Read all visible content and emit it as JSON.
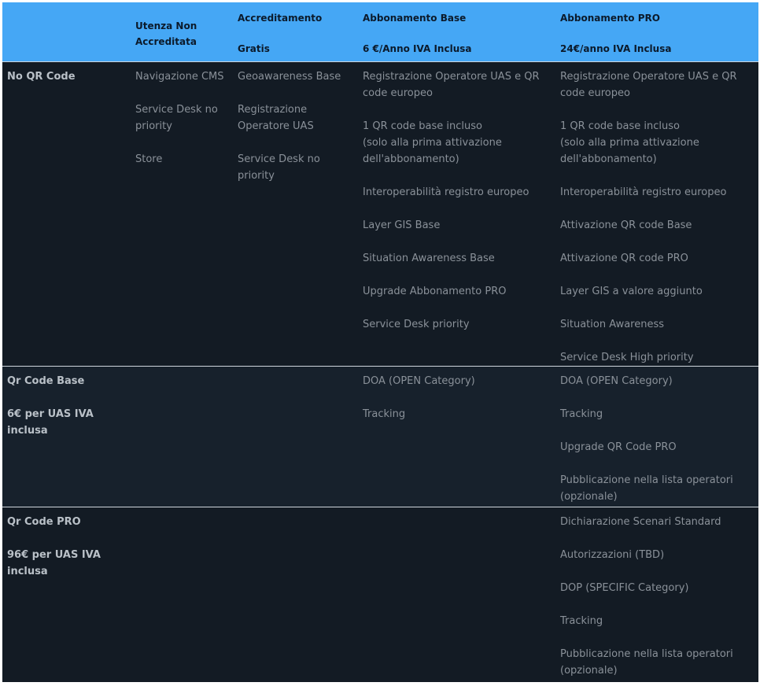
{
  "header": {
    "col0": "",
    "col1": "Utenza Non\nAccreditata",
    "col2_line1": "Accreditamento",
    "col2_line2": "Gratis",
    "col3_line1": "Abbonamento Base",
    "col3_line2": "6 €/Anno IVA Inclusa",
    "col4_line1": "Abbonamento PRO",
    "col4_line2": "24€/anno IVA Inclusa"
  },
  "rows": [
    {
      "label": [
        "No QR Code"
      ],
      "col1": [
        "Navigazione CMS",
        "Service Desk no\npriority",
        "Store"
      ],
      "col2": [
        "Geoawareness Base",
        "Registrazione\nOperatore UAS",
        "Service Desk no\npriority"
      ],
      "col3": [
        "Registrazione Operatore UAS e QR\ncode europeo",
        "1 QR code base incluso\n(solo alla prima attivazione\ndell'abbonamento)",
        "Interoperabilità registro europeo",
        "Layer GIS Base",
        "Situation Awareness Base",
        "Upgrade Abbonamento PRO",
        "Service Desk priority"
      ],
      "col4": [
        "Registrazione Operatore UAS e QR\ncode europeo",
        "1 QR code base incluso\n(solo alla prima attivazione\ndell'abbonamento)",
        "Interoperabilità registro europeo",
        "Attivazione QR code Base",
        "Attivazione QR code PRO",
        "Layer GIS a valore aggiunto",
        "Situation Awareness",
        "Service Desk High priority"
      ]
    },
    {
      "label": [
        "Qr Code Base",
        "6€ per UAS IVA\ninclusa"
      ],
      "col1": [],
      "col2": [],
      "col3": [
        "DOA (OPEN Category)",
        "Tracking"
      ],
      "col4": [
        "DOA (OPEN Category)",
        "Tracking",
        "Upgrade QR Code PRO",
        "Pubblicazione nella lista operatori\n(opzionale)"
      ]
    },
    {
      "label": [
        "Qr Code PRO",
        "96€ per UAS IVA\ninclusa"
      ],
      "col1": [],
      "col2": [],
      "col3": [],
      "col4": [
        "Dichiarazione Scenari Standard",
        "Autorizzazioni (TBD)",
        "DOP (SPECIFIC Category)",
        "Tracking",
        "Pubblicazione nella lista operatori\n(opzionale)"
      ]
    }
  ],
  "colors": {
    "header_bg": "#45a7f5",
    "body_bg": "#131b24",
    "text": "#8a9199"
  }
}
